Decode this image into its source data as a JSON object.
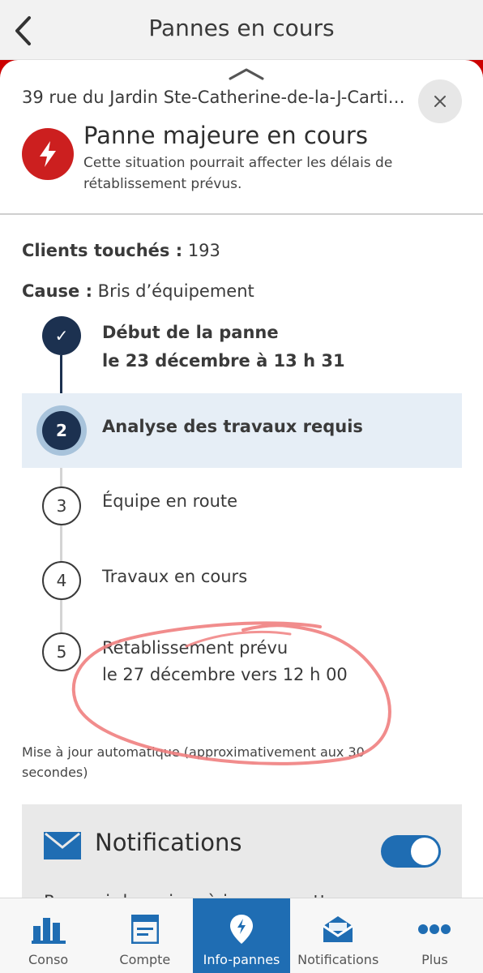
{
  "header": {
    "title": "Pannes en cours"
  },
  "panel": {
    "address": "39 rue du Jardin Ste-Catherine-de-la-J-Carti…",
    "alert_title": "Panne majeure en cours",
    "alert_text": "Cette situation pourrait affecter les délais de rétablissement prévus."
  },
  "details": {
    "clients_label": "Clients touchés :",
    "clients_value": "193",
    "cause_label": "Cause :",
    "cause_value": "Bris d’équipement"
  },
  "steps": [
    {
      "marker": "✓",
      "label": "Début de la panne",
      "sub": "le 23 décembre à 13 h 31",
      "state": "done"
    },
    {
      "marker": "2",
      "label": "Analyse des travaux requis",
      "state": "current"
    },
    {
      "marker": "3",
      "label": "Équipe en route",
      "state": "todo"
    },
    {
      "marker": "4",
      "label": "Travaux en cours",
      "state": "todo"
    },
    {
      "marker": "5",
      "label": "Rétablissement prévu",
      "sub": "le 27 décembre vers 12 h 00",
      "state": "todo"
    }
  ],
  "auto_update": "Mise à jour automatique (approximativement aux 30 secondes)",
  "notifications": {
    "title": "Notifications",
    "toggle_on": true,
    "description": "Recevoir les mises à jour sur cette panne"
  },
  "nav": [
    {
      "label": "Conso",
      "icon": "bar-chart-icon"
    },
    {
      "label": "Compte",
      "icon": "bill-icon"
    },
    {
      "label": "Info-pannes",
      "icon": "outage-pin-icon",
      "active": true
    },
    {
      "label": "Notifications",
      "icon": "envelope-open-icon"
    },
    {
      "label": "Plus",
      "icon": "more-icon"
    }
  ],
  "colors": {
    "brand_red": "#cc1f1f",
    "navy": "#1c3150",
    "accent_blue": "#1f6db3",
    "highlight_row": "#e6eef6",
    "scribble": "#f08080"
  }
}
